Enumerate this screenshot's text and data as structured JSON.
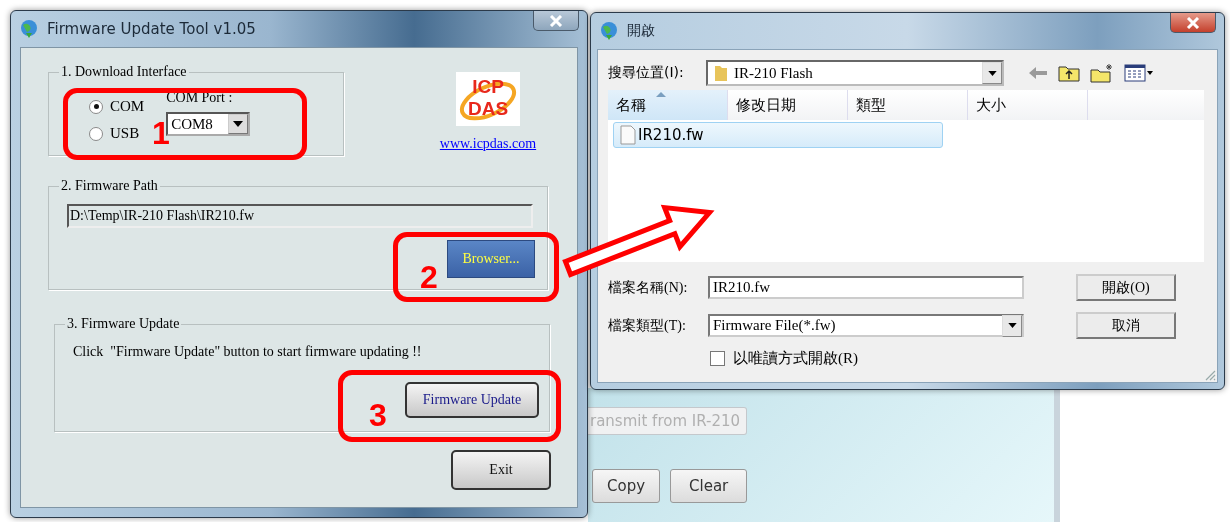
{
  "tool_window": {
    "title": "Firmware Update Tool v1.05",
    "download_interface": {
      "legend": "1. Download Interface",
      "options": [
        {
          "label": "COM",
          "selected": true
        },
        {
          "label": "USB",
          "selected": false
        }
      ],
      "port_label": "COM Port :",
      "port_value": "COM8"
    },
    "logo_text": [
      "ICP",
      "DAS"
    ],
    "link": "www.icpdas.com",
    "firmware_path": {
      "legend": "2. Firmware Path",
      "value": "D:\\Temp\\IR-210 Flash\\IR210.fw",
      "button": "Browser..."
    },
    "firmware_update": {
      "legend": "3. Firmware Update",
      "message": "Click  \"Firmware Update\" button to start firmware updating !!",
      "button": "Firmware Update"
    },
    "exit_button": "Exit"
  },
  "annotations": [
    {
      "label": "1"
    },
    {
      "label": "2"
    },
    {
      "label": "3"
    }
  ],
  "open_dialog": {
    "title": "開啟",
    "look_in_label": "搜尋位置(I):",
    "look_in_value": "IR-210 Flash",
    "columns": [
      "名稱",
      "修改日期",
      "類型",
      "大小"
    ],
    "files": [
      {
        "name": "IR210.fw",
        "selected": true
      }
    ],
    "file_name_label": "檔案名稱(N):",
    "file_name_value": "IR210.fw",
    "file_type_label": "檔案類型(T):",
    "file_type_value": "Firmware File(*.fw)",
    "read_only": {
      "label": "以唯讀方式開啟(R)",
      "checked": false
    },
    "buttons": [
      "開啟(O)",
      "取消"
    ]
  },
  "background_window": {
    "buttons": [
      "ransmit from IR-210",
      "Copy",
      "Clear"
    ]
  }
}
